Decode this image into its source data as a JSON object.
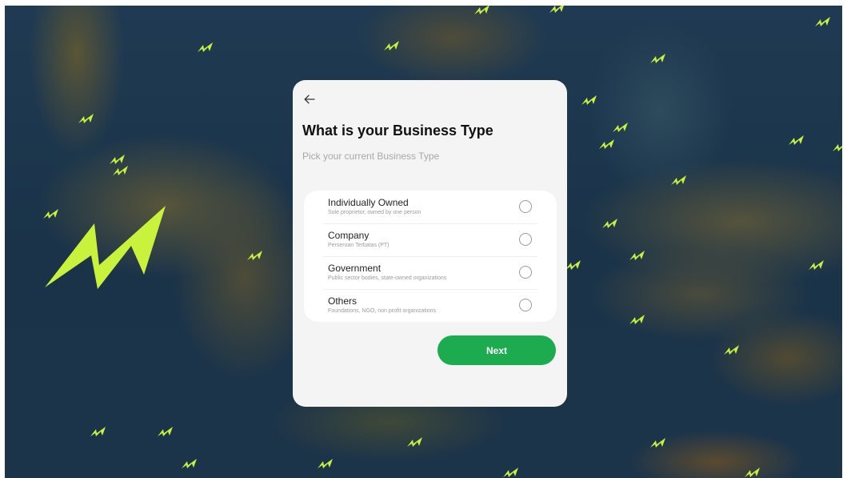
{
  "colors": {
    "background": "#1c344a",
    "bolt": "#c9f23d",
    "card": "#f4f4f4",
    "primary_button": "#1dab4f",
    "title_text": "#111111"
  },
  "icons": {
    "back": "arrow-left-icon",
    "decoration": "lightning-bolt-icon",
    "option_control": "radio-unchecked-icon"
  },
  "form": {
    "title": "What is your Business Type",
    "subtitle": "Pick your current Business Type",
    "options": [
      {
        "label": "Individually Owned",
        "description": "Sole proprietor, owned by one person",
        "selected": false
      },
      {
        "label": "Company",
        "description": "Perseroan Terbatas (PT)",
        "selected": false
      },
      {
        "label": "Government",
        "description": "Public sector bodies, state-owned organizations",
        "selected": false
      },
      {
        "label": "Others",
        "description": "Foundations, NGO, non profit organizations",
        "selected": false
      }
    ],
    "next_label": "Next"
  }
}
